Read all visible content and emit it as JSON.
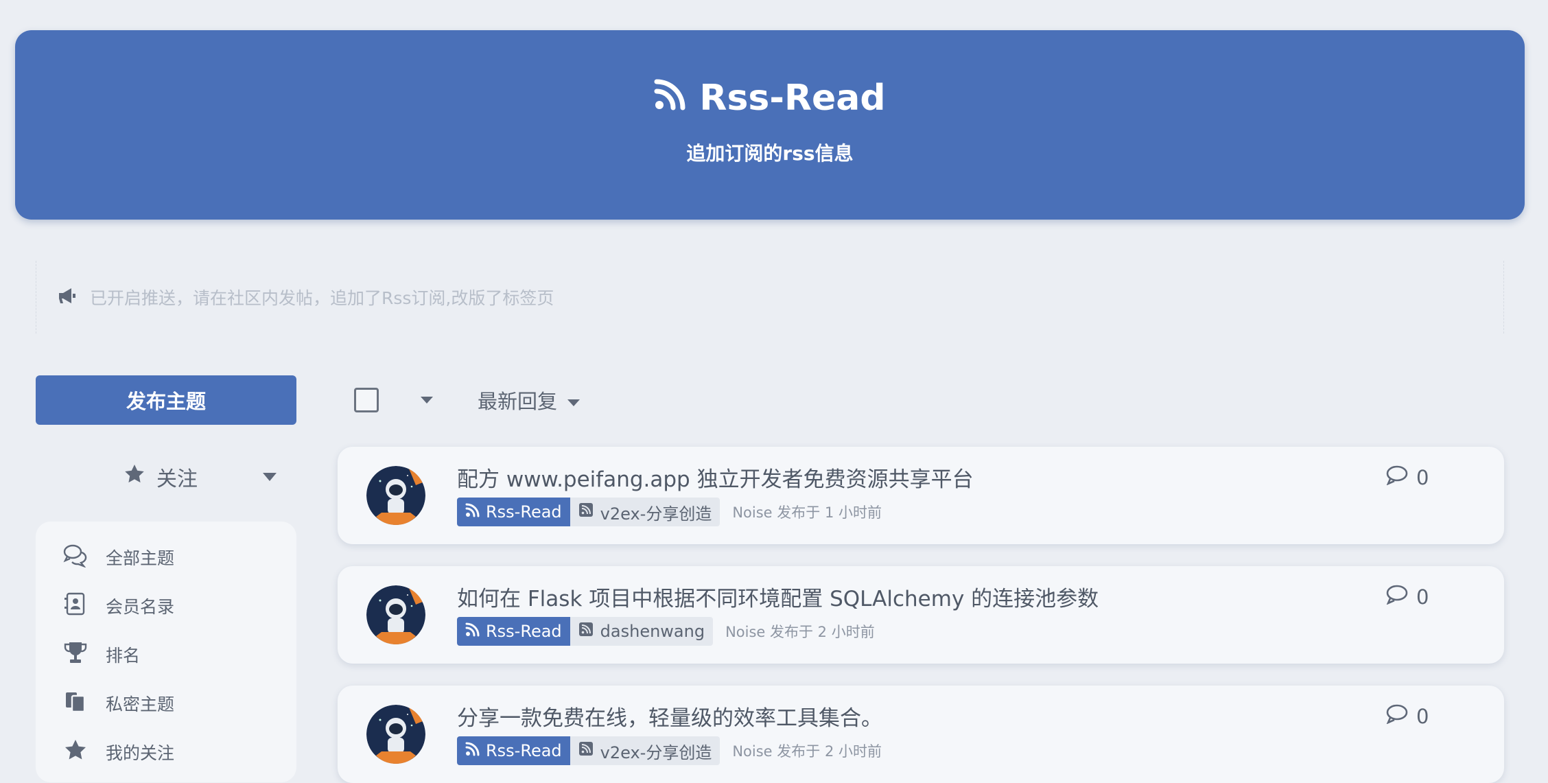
{
  "header": {
    "title": "Rss-Read",
    "subtitle": "追加订阅的rss信息",
    "icon": "rss-icon",
    "color": "#4a70b8"
  },
  "notice": {
    "icon": "megaphone-icon",
    "text": "已开启推送，请在社区内发帖，追加了Rss订阅,改版了标签页"
  },
  "sidebar": {
    "post_button": "发布主题",
    "follow_label": "关注",
    "items": [
      {
        "label": "全部主题",
        "icon": "comments-icon"
      },
      {
        "label": "会员名录",
        "icon": "address-book-icon"
      },
      {
        "label": "排名",
        "icon": "trophy-icon"
      },
      {
        "label": "私密主题",
        "icon": "copy-icon"
      },
      {
        "label": "我的关注",
        "icon": "star-icon"
      }
    ]
  },
  "toolbar": {
    "sort_label": "最新回复"
  },
  "discussions": [
    {
      "title": "配方 www.peifang.app 独立开发者免费资源共享平台",
      "tag": "Rss-Read",
      "source": "v2ex-分享创造",
      "meta": "Noise 发布于 1 小时前",
      "comments": "0"
    },
    {
      "title": "如何在 Flask 项目中根据不同环境配置 SQLAlchemy 的连接池参数",
      "tag": "Rss-Read",
      "source": "dashenwang",
      "meta": "Noise 发布于 2 小时前",
      "comments": "0"
    },
    {
      "title": "分享一款免费在线，轻量级的效率工具集合。",
      "tag": "Rss-Read",
      "source": "v2ex-分享创造",
      "meta": "Noise 发布于 2 小时前",
      "comments": "0"
    }
  ]
}
